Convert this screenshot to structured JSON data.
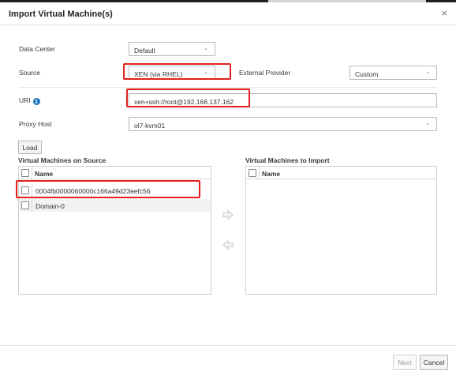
{
  "dialog": {
    "title": "Import Virtual Machine(s)",
    "close": "×"
  },
  "form": {
    "data_center": {
      "label": "Data Center",
      "value": "Default"
    },
    "source": {
      "label": "Source",
      "value": "XEN (via RHEL)"
    },
    "external_provider": {
      "label": "External Provider",
      "value": "Custom"
    },
    "uri": {
      "label": "URI",
      "value": "xen+ssh://root@192.168.137.162",
      "info_icon": "i"
    },
    "proxy_host": {
      "label": "Proxy Host",
      "value": "ol7-kvm01"
    },
    "load_label": "Load"
  },
  "source_panel": {
    "title": "Virtual Machines on Source",
    "column": "Name",
    "rows": [
      "0004fb0000060000c166a49d23eefc56",
      "Domain-0"
    ]
  },
  "import_panel": {
    "title": "Virtual Machines to Import",
    "column": "Name",
    "rows": []
  },
  "footer": {
    "next_label": "Next",
    "cancel_label": "Cancel"
  },
  "colors": {
    "accent": "#1d76c2",
    "highlight": "#e0211b"
  },
  "icons": {
    "move_right": "arrow-right-icon",
    "move_left": "arrow-left-icon",
    "info": "info-icon"
  }
}
